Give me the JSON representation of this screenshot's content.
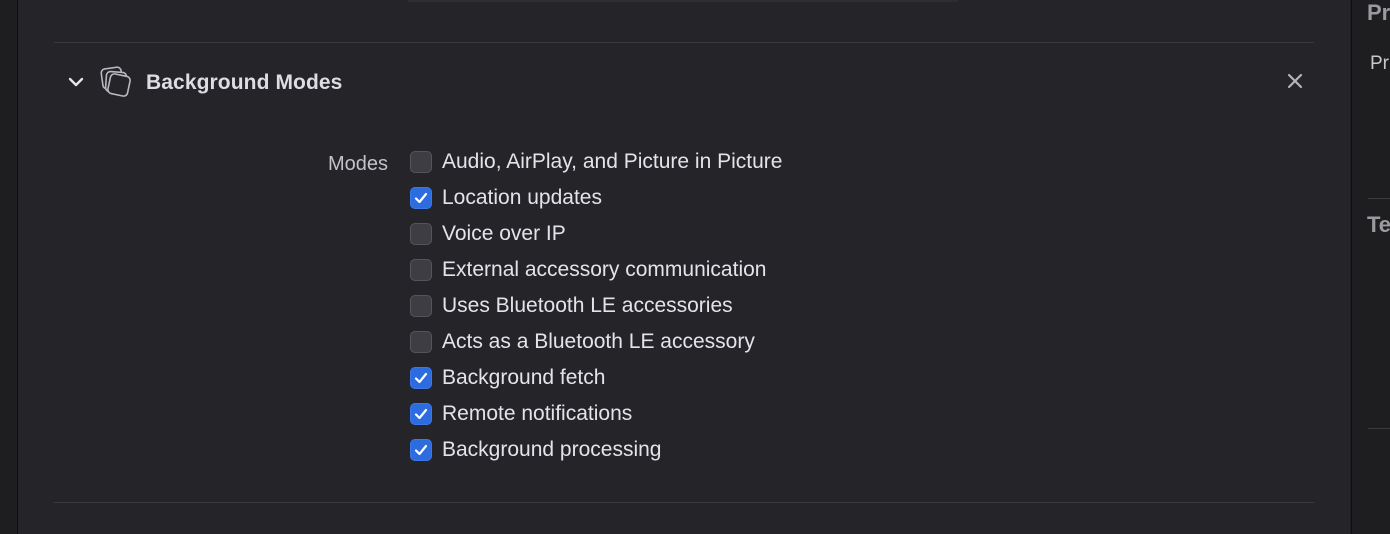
{
  "capability": {
    "title": "Background Modes",
    "icon": "stacked-windows-icon",
    "expanded": true
  },
  "modes": {
    "label": "Modes",
    "items": [
      {
        "label": "Audio, AirPlay, and Picture in Picture",
        "checked": false
      },
      {
        "label": "Location updates",
        "checked": true
      },
      {
        "label": "Voice over IP",
        "checked": false
      },
      {
        "label": "External accessory communication",
        "checked": false
      },
      {
        "label": "Uses Bluetooth LE accessories",
        "checked": false
      },
      {
        "label": "Acts as a Bluetooth LE accessory",
        "checked": false
      },
      {
        "label": "Background fetch",
        "checked": true
      },
      {
        "label": "Remote notifications",
        "checked": true
      },
      {
        "label": "Background processing",
        "checked": true
      }
    ]
  },
  "inspector": {
    "heading_1": "Pr",
    "sub_1": "Pr",
    "heading_2": "Te"
  },
  "colors": {
    "accent": "#2d6cdf",
    "background": "#252429"
  }
}
